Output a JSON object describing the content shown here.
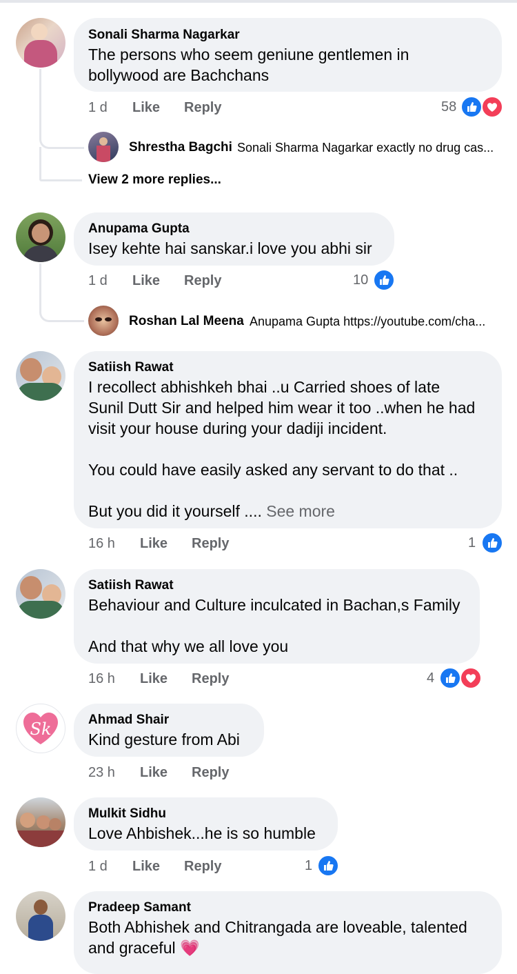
{
  "comments": [
    {
      "name": "Sonali Sharma Nagarkar",
      "text": "The  persons who seem geniune gentlemen  in\nbollywood  are Bachchans",
      "time": "1 d",
      "like_label": "Like",
      "reply_label": "Reply",
      "reaction_count": "58",
      "reactions": [
        "like-icon",
        "love-icon"
      ],
      "replies": [
        {
          "name": "Shrestha Bagchi",
          "text": "Sonali Sharma Nagarkar exactly no drug cas..."
        }
      ],
      "view_more": "View 2 more replies..."
    },
    {
      "name": "Anupama Gupta",
      "text": "Isey kehte hai sanskar.i love you abhi sir",
      "time": "1 d",
      "like_label": "Like",
      "reply_label": "Reply",
      "reaction_count": "10",
      "reactions": [
        "like-icon"
      ],
      "replies": [
        {
          "name": "Roshan Lal Meena",
          "text": "Anupama Gupta https://youtube.com/cha..."
        }
      ]
    },
    {
      "name": "Satiish Rawat",
      "text": "I recollect abhishkeh bhai ..u Carried shoes of  late\nSunil Dutt Sir and helped him wear it too ..when he had\nvisit   your house during your dadiji incident.\n\nYou could have easily asked any servant to do that ..\n\nBut you did it yourself ....",
      "see_more": "See more",
      "time": "16 h",
      "like_label": "Like",
      "reply_label": "Reply",
      "reaction_count": "1",
      "reactions": [
        "like-icon"
      ]
    },
    {
      "name": "Satiish Rawat",
      "text": "Behaviour and Culture inculcated in Bachan,s Family\n\nAnd that why  we all love you",
      "time": "16 h",
      "like_label": "Like",
      "reply_label": "Reply",
      "reaction_count": "4",
      "reactions": [
        "like-icon",
        "love-icon"
      ]
    },
    {
      "name": "Ahmad Shair",
      "avatar_text": "Sk",
      "text": "Kind gesture from Abi",
      "time": "23 h",
      "like_label": "Like",
      "reply_label": "Reply"
    },
    {
      "name": "Mulkit Sidhu",
      "text": "Love Ahbishek...he is so humble",
      "time": "1 d",
      "like_label": "Like",
      "reply_label": "Reply",
      "reaction_count": "1",
      "reactions": [
        "like-icon"
      ]
    },
    {
      "name": "Pradeep Samant",
      "text": "Both Abhishek and Chitrangada are loveable, talented\nand graceful",
      "emoji": "💗"
    }
  ],
  "colors": {
    "like_blue": "#1877f2",
    "love_red": "#f33e58",
    "bubble_gray": "#f0f2f5",
    "meta_gray": "#65676b"
  }
}
